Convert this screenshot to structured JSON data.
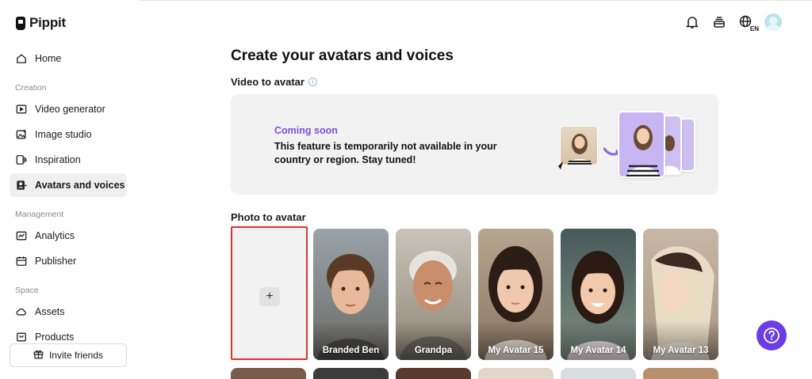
{
  "app": {
    "name": "Pippit"
  },
  "sidebar": {
    "home": "Home",
    "sections": [
      {
        "label": "Creation",
        "items": [
          "Video generator",
          "Image studio",
          "Inspiration",
          "Avatars and voices"
        ]
      },
      {
        "label": "Management",
        "items": [
          "Analytics",
          "Publisher"
        ]
      },
      {
        "label": "Space",
        "items": [
          "Assets",
          "Products"
        ]
      }
    ],
    "active_item": "Avatars and voices",
    "invite_label": "Invite friends"
  },
  "header": {
    "language_badge": "EN"
  },
  "main": {
    "title": "Create your avatars and voices",
    "video_to_avatar": {
      "title": "Video to avatar",
      "coming_soon": "Coming soon",
      "message": "This feature is temporarily not available in your country or region. Stay tuned!"
    },
    "photo_to_avatar": {
      "title": "Photo to avatar",
      "upload_symbol": "+",
      "avatars": [
        {
          "name": "Branded Ben"
        },
        {
          "name": "Grandpa"
        },
        {
          "name": "My Avatar 15"
        },
        {
          "name": "My Avatar 14"
        },
        {
          "name": "My Avatar 13"
        }
      ]
    }
  },
  "colors": {
    "accent": "#7b4ee0",
    "help_button": "#6a3de8",
    "selected_outline": "#e03131"
  }
}
